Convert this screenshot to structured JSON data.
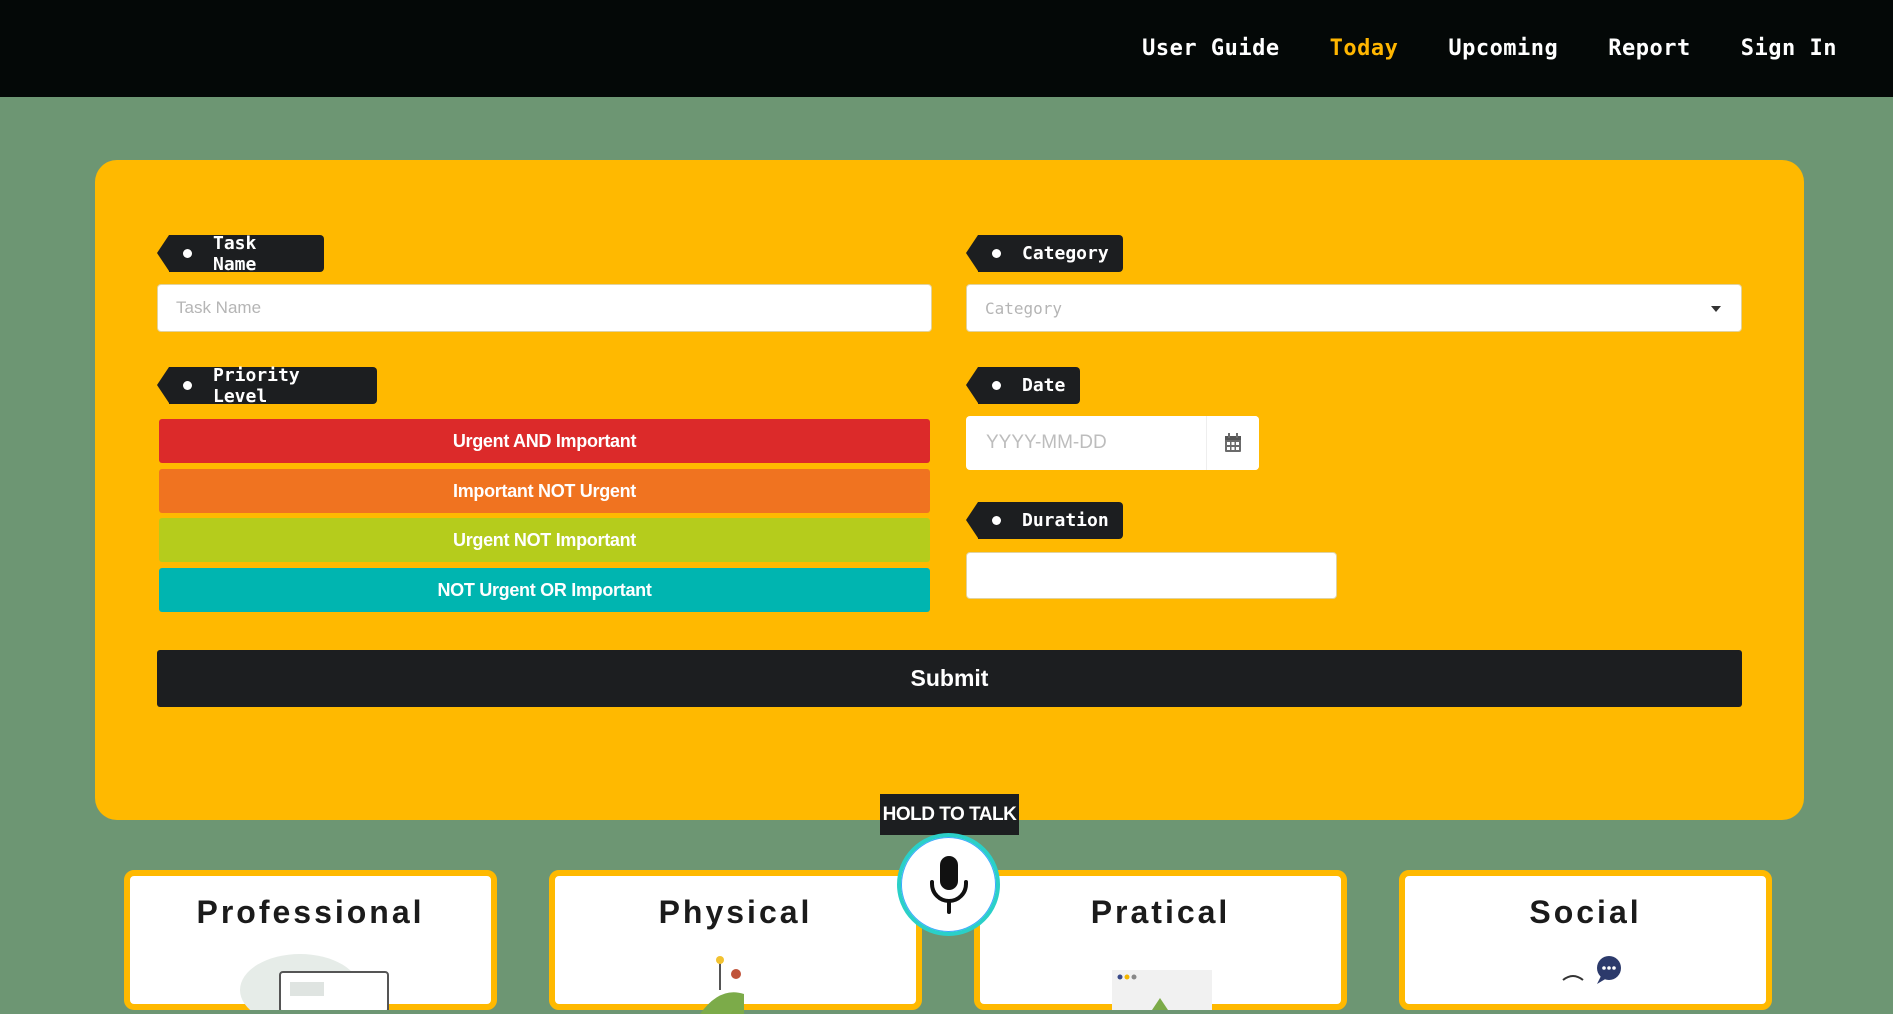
{
  "nav": {
    "items": [
      {
        "label": "User Guide"
      },
      {
        "label": "Today"
      },
      {
        "label": "Upcoming"
      },
      {
        "label": "Report"
      },
      {
        "label": "Sign In"
      }
    ],
    "active_color": "#ffb600"
  },
  "form": {
    "task_name_label": "Task Name",
    "task_name_placeholder": "Task Name",
    "category_label": "Category",
    "category_placeholder": "Category",
    "priority_label": "Priority Level",
    "priorities": [
      {
        "label": "Urgent AND Important",
        "color": "#dc2a2a"
      },
      {
        "label": "Important NOT Urgent",
        "color": "#f07320"
      },
      {
        "label": "Urgent NOT Important",
        "color": "#b5cc1c"
      },
      {
        "label": "NOT Urgent OR Important",
        "color": "#00b5b0"
      }
    ],
    "date_label": "Date",
    "date_placeholder": "YYYY-MM-DD",
    "duration_label": "Duration",
    "duration_value": "",
    "submit_label": "Submit"
  },
  "talk": {
    "tooltip": "HOLD TO TALK"
  },
  "categories": [
    {
      "title": "Professional"
    },
    {
      "title": "Physical"
    },
    {
      "title": "Pratical"
    },
    {
      "title": "Social"
    }
  ],
  "colors": {
    "background": "#6d9673",
    "card": "#ffb900",
    "dark": "#1c1e20"
  }
}
